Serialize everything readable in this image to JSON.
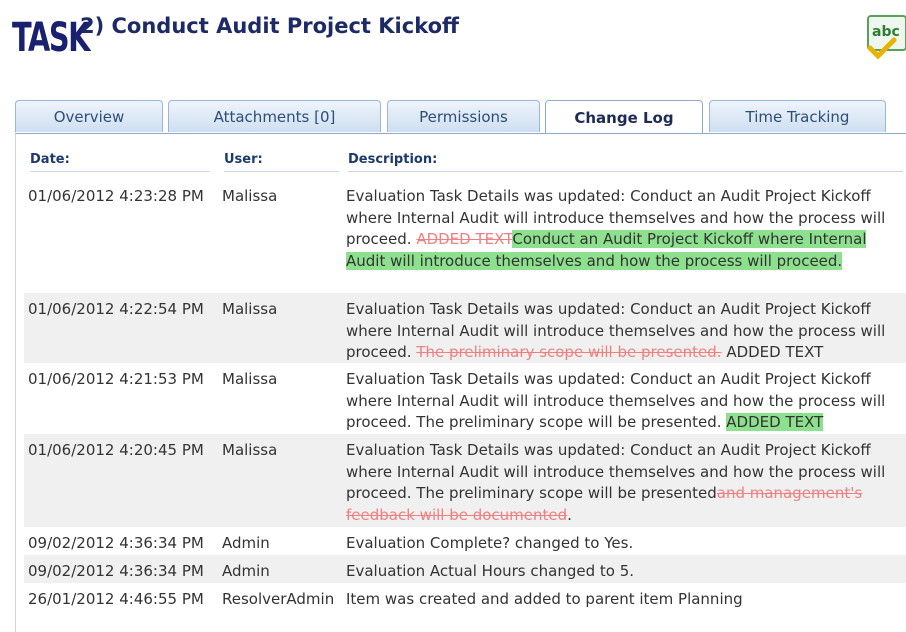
{
  "header": {
    "logo_text": "TASK",
    "title": "2) Conduct Audit Project Kickoff",
    "icon": "spellcheck-icon",
    "icon_text": "abc"
  },
  "tabs": [
    {
      "label": "Overview",
      "active": false
    },
    {
      "label": "Attachments [0]",
      "active": false
    },
    {
      "label": "Permissions",
      "active": false
    },
    {
      "label": "Change Log",
      "active": true
    },
    {
      "label": "Time Tracking",
      "active": false
    }
  ],
  "columns": {
    "date": "Date:",
    "user": "User:",
    "description": "Description:"
  },
  "rows": [
    {
      "date": "01/06/2012 4:23:28 PM",
      "user": "Malissa",
      "desc_prefix": "Evaluation Task Details was updated: Conduct an Audit Project Kickoff where Internal Audit will introduce themselves and how the process will proceed. ",
      "deleted": "ADDED TEXT",
      "added": "Conduct an Audit Project Kickoff where Internal Audit will introduce themselves and how the process will proceed.",
      "desc_suffix": ""
    },
    {
      "date": "01/06/2012 4:22:54 PM",
      "user": "Malissa",
      "desc_prefix": "Evaluation Task Details was updated: Conduct an Audit Project Kickoff where Internal Audit will introduce themselves and how the process will proceed. ",
      "deleted": "The preliminary scope will be presented.",
      "added": "",
      "desc_suffix": " ADDED TEXT"
    },
    {
      "date": "01/06/2012 4:21:53 PM",
      "user": "Malissa",
      "desc_prefix": "Evaluation Task Details was updated: Conduct an Audit Project Kickoff where Internal Audit will introduce themselves and how the process will proceed. The preliminary scope will be presented. ",
      "deleted": "",
      "added": "ADDED TEXT",
      "desc_suffix": ""
    },
    {
      "date": "01/06/2012 4:20:45 PM",
      "user": "Malissa",
      "desc_prefix": "Evaluation Task Details was updated: Conduct an Audit Project Kickoff where Internal Audit will introduce themselves and how the process will proceed. The preliminary scope will be presented",
      "deleted": "and management's feedback will be documented",
      "added": "",
      "desc_suffix": "."
    },
    {
      "date": "09/02/2012 4:36:34 PM",
      "user": "Admin",
      "desc_prefix": "Evaluation Complete? changed to Yes.",
      "deleted": "",
      "added": "",
      "desc_suffix": ""
    },
    {
      "date": "09/02/2012 4:36:34 PM",
      "user": "Admin",
      "desc_prefix": "Evaluation Actual Hours changed to 5.",
      "deleted": "",
      "added": "",
      "desc_suffix": ""
    },
    {
      "date": "26/01/2012 4:46:55 PM",
      "user": "ResolverAdmin",
      "desc_prefix": "Item was created and added to parent item Planning",
      "deleted": "",
      "added": "",
      "desc_suffix": ""
    }
  ],
  "colors": {
    "deleted_text": "#f08080",
    "added_highlight": "#8de08d",
    "title": "#1d2a66"
  }
}
